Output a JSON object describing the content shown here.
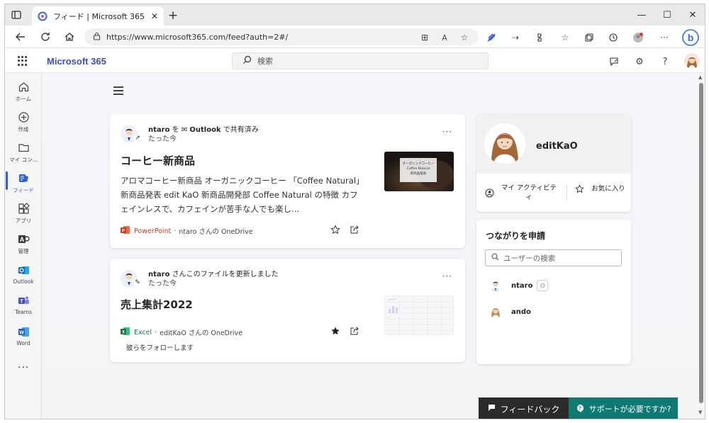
{
  "browser": {
    "tab_title": "フィード | Microsoft 365",
    "url": "https://www.microsoft365.com/feed?auth=2#/"
  },
  "header": {
    "brand": "Microsoft 365",
    "search_placeholder": "検索"
  },
  "rail": {
    "items": [
      {
        "label": "ホーム",
        "icon": "home-icon"
      },
      {
        "label": "作成",
        "icon": "create-icon"
      },
      {
        "label": "マイ コン...",
        "icon": "folder-icon"
      },
      {
        "label": "フィード",
        "icon": "feed-icon",
        "active": true
      },
      {
        "label": "アプリ",
        "icon": "apps-icon"
      },
      {
        "label": "管理",
        "icon": "admin-icon"
      },
      {
        "label": "Outlook",
        "icon": "outlook-icon"
      },
      {
        "label": "Teams",
        "icon": "teams-icon"
      },
      {
        "label": "Word",
        "icon": "word-icon"
      }
    ],
    "more": "..."
  },
  "feed": {
    "cards": [
      {
        "user": "ntaro",
        "action_pre": " を ",
        "channel": "Outlook",
        "action_post": " で共有済み",
        "time": "たった今",
        "title": "コーヒー新商品",
        "description": "アロマコーヒー新商品 オーガニックコーヒー 「Coffee Natural」 新商品発表 edit KaO 新商品開発部 Coffee Natural の特徴 カフェインレスで、カフェインが苦手な人でも楽し...",
        "app": "PowerPoint",
        "location": "ntaro さんの OneDrive",
        "thumb_text": [
          "オーガニックコーヒー",
          "Coffee Natural",
          "新商品発表"
        ]
      },
      {
        "user": "ntaro",
        "action_post": " さんこのファイルを更新しました",
        "time": "たった今",
        "title": "売上集計2022",
        "app": "Excel",
        "location": "editKaO さんの OneDrive",
        "follow_text": "彼らをフォローします"
      }
    ]
  },
  "profile": {
    "name": "editKaO",
    "activity_label": "マイ アクティビティ",
    "favorites_label": "お気に入り"
  },
  "connections": {
    "title": "つながりを申請",
    "search_placeholder": "ユーザーの検索",
    "people": [
      {
        "name": "ntaro"
      },
      {
        "name": "ando"
      }
    ]
  },
  "footer": {
    "feedback_label": "フィードバック",
    "help_label": "サポートが必要ですか?"
  },
  "colors": {
    "brand_blue": "#3b4fc4",
    "rail_active": "#2f5fd8",
    "powerpoint": "#c43e1c",
    "excel": "#1d7044",
    "help_teal": "#0e7a72"
  }
}
